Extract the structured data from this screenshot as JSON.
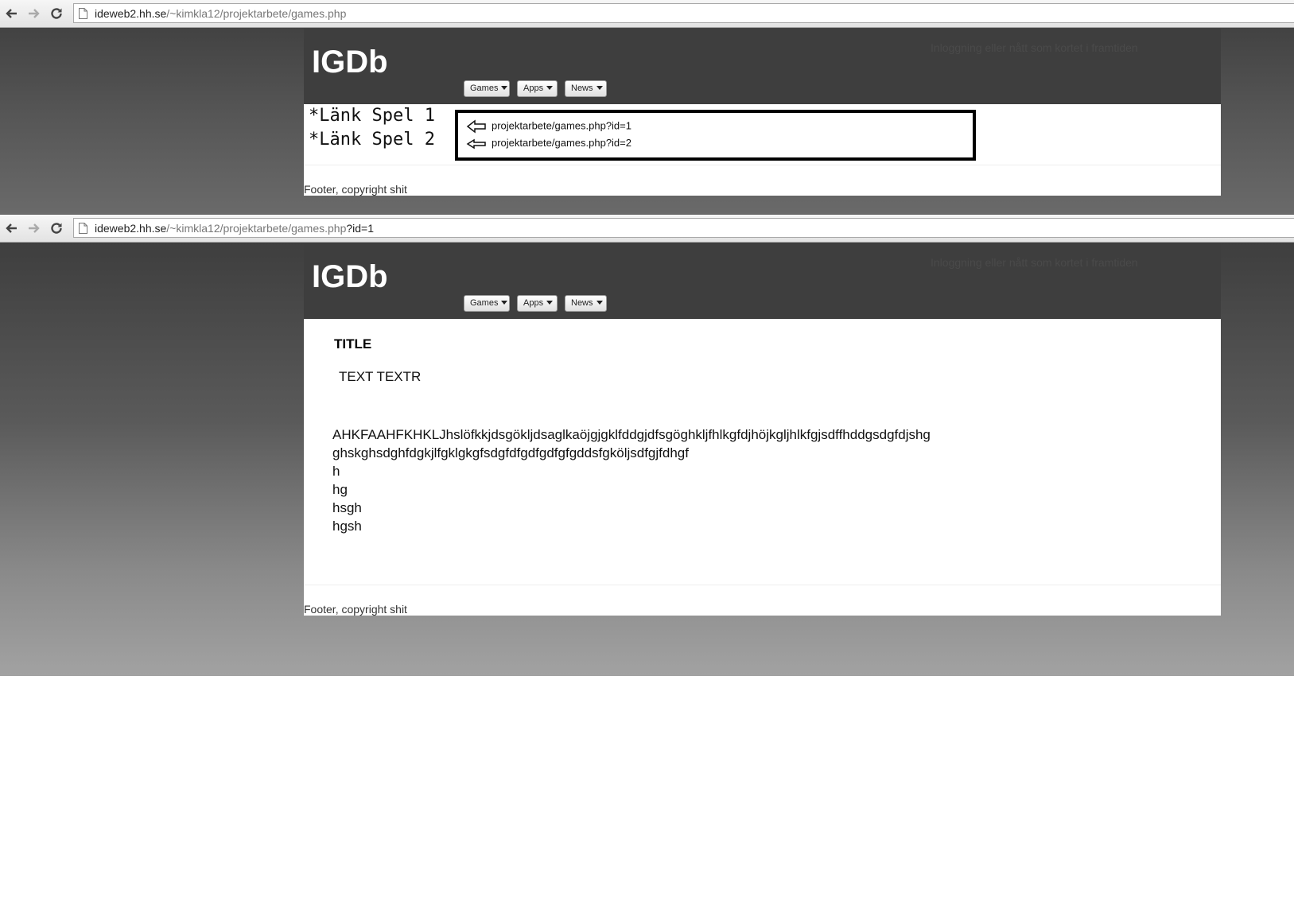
{
  "screen1": {
    "url_host": "ideweb2.hh.se",
    "url_path": "/~kimkla12/projektarbete/games.php",
    "url_query": "",
    "logo": "IGDb",
    "login_text": "Inloggning eller nått som kortet i framtiden",
    "menu": [
      {
        "label": "Games"
      },
      {
        "label": "Apps"
      },
      {
        "label": "News"
      }
    ],
    "links": [
      "*Länk Spel 1",
      "*Länk Spel 2"
    ],
    "annotations": [
      "projektarbete/games.php?id=1",
      "projektarbete/games.php?id=2"
    ],
    "footer": "Footer, copyright shit"
  },
  "screen2": {
    "url_host": "ideweb2.hh.se",
    "url_path": "/~kimkla12/projektarbete/games.php",
    "url_query": "?id=1",
    "logo": "IGDb",
    "login_text": "Inloggning eller nått som kortet i framtiden",
    "menu": [
      {
        "label": "Games"
      },
      {
        "label": "Apps"
      },
      {
        "label": "News"
      }
    ],
    "title": "TITLE",
    "text": "TEXT TEXTR",
    "body_lines": [
      "AHKFAAHFKHKLJhslöfkkjdsgökljdsaglkaöjgjgklfddgjdfsgöghkljfhlkgfdjhöjkgljhlkfgjsdffhddgsdgfdjshg",
      "ghskghsdghfdgkjlfgklgkgfsdgfdfgdfgdfgfgddsfgköljsdfgjfdhgf",
      "h",
      "hg",
      "hsgh",
      "hgsh"
    ],
    "footer": "Footer, copyright shit"
  }
}
